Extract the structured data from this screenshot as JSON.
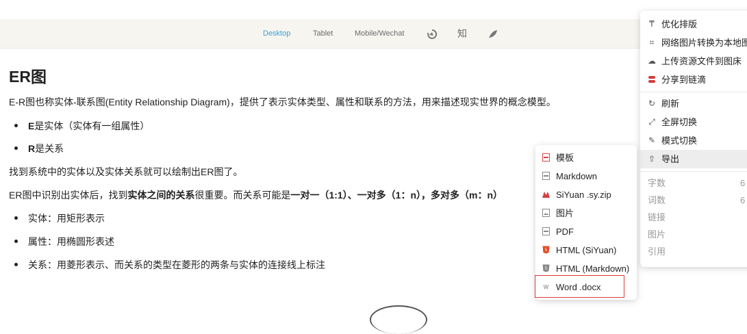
{
  "toolbar": {
    "desktop": "Desktop",
    "tablet": "Tablet",
    "mobile": "Mobile/Wechat",
    "zhi": "知",
    "icons": [
      "refresh-swirl-icon",
      "zhihu-icon",
      "feather-icon"
    ],
    "active_color": "#3aa0d8"
  },
  "doc": {
    "title": "ER图",
    "intro": "E-R图也称实体-联系图(Entity Relationship Diagram)，提供了表示实体类型、属性和联系的方法，用来描述现实世界的概念模型。",
    "list1": [
      {
        "bold": "E",
        "text": "是实体（实体有一组属性）"
      },
      {
        "bold": "R",
        "text": "是关系"
      }
    ],
    "para2": "找到系统中的实体以及实体关系就可以绘制出ER图了。",
    "para3_a": "ER图中识别出实体后，找到",
    "para3_b": "实体之间的关系",
    "para3_c": "很重要。而关系可能是",
    "para3_d": "一对一（1:1）、一对多（1：n），多对多（m：n）",
    "list2": [
      "实体：用矩形表示",
      "属性：用椭圆形表述",
      "关系：用菱形表示、而关系的类型在菱形的两条与实体的连接线上标注"
    ]
  },
  "menu": {
    "items": [
      {
        "label": "优化排版",
        "icon": "format-paint-icon"
      },
      {
        "label": "网络图片转换为本地图",
        "icon": "crop-icon"
      },
      {
        "label": "上传资源文件到图床",
        "icon": "cloud-icon"
      },
      {
        "label": "分享到链滴",
        "icon": "liandi-logo-icon"
      },
      {
        "label": "刷新",
        "icon": "refresh-icon"
      },
      {
        "label": "全屏切换",
        "icon": "fullscreen-icon"
      },
      {
        "label": "模式切换",
        "icon": "pencil-icon"
      },
      {
        "label": "导出",
        "icon": "upload-icon"
      }
    ],
    "stats": [
      {
        "label": "字数",
        "value": "6"
      },
      {
        "label": "词数",
        "value": "6"
      },
      {
        "label": "链接",
        "value": ""
      },
      {
        "label": "图片",
        "value": ""
      },
      {
        "label": "引用",
        "value": ""
      }
    ]
  },
  "export_submenu": {
    "items": [
      {
        "label": "模板",
        "icon": "template-file-icon"
      },
      {
        "label": "Markdown",
        "icon": "markdown-file-icon"
      },
      {
        "label": "SiYuan .sy.zip",
        "icon": "siyuan-logo-icon"
      },
      {
        "label": "图片",
        "icon": "image-file-icon"
      },
      {
        "label": "PDF",
        "icon": "pdf-file-icon"
      },
      {
        "label": "HTML (SiYuan)",
        "icon": "html5-icon"
      },
      {
        "label": "HTML (Markdown)",
        "icon": "html5-gray-icon"
      },
      {
        "label": "Word .docx",
        "icon": "word-icon"
      }
    ],
    "highlight_color": "#d93a3a"
  }
}
